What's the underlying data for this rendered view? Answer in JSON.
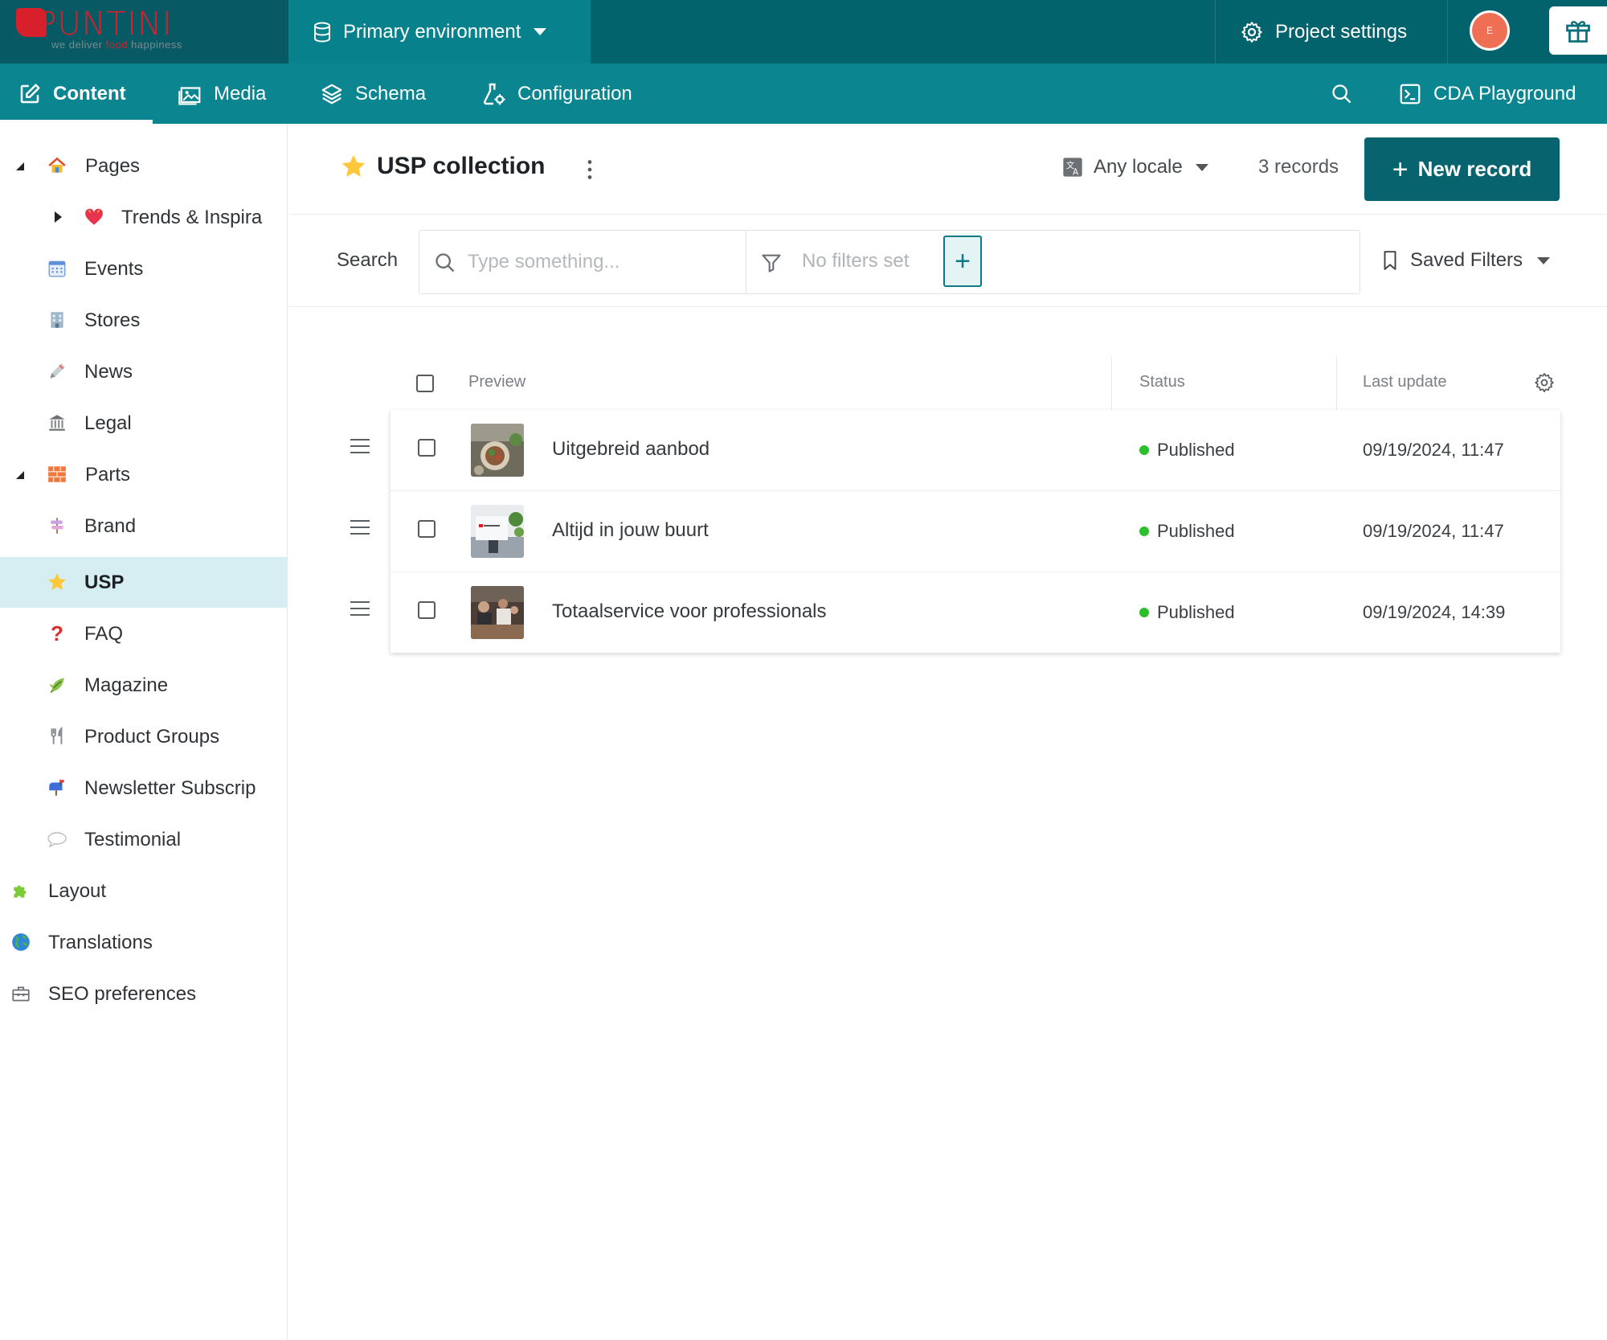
{
  "brand": {
    "name": "SPUNTINI",
    "tagline_pre": "we deliver ",
    "tagline_mid": "food",
    "tagline_post": " happiness"
  },
  "topbar": {
    "environment": "Primary environment",
    "project_settings": "Project settings",
    "avatar_initial": "E"
  },
  "nav": {
    "content": "Content",
    "media": "Media",
    "schema": "Schema",
    "configuration": "Configuration",
    "cda_playground": "CDA Playground"
  },
  "sidebar": {
    "items": [
      {
        "label": "Pages",
        "icon": "house-icon"
      },
      {
        "label": "Trends & Inspira",
        "icon": "heart-icon"
      },
      {
        "label": "Events",
        "icon": "calendar-icon"
      },
      {
        "label": "Stores",
        "icon": "building-icon"
      },
      {
        "label": "News",
        "icon": "pen-icon"
      },
      {
        "label": "Legal",
        "icon": "court-icon"
      },
      {
        "label": "Parts",
        "icon": "bricks-icon"
      },
      {
        "label": "Brand",
        "icon": "signpost-icon"
      },
      {
        "label": "USP",
        "icon": "star-icon"
      },
      {
        "label": "FAQ",
        "icon": "question-icon"
      },
      {
        "label": "Magazine",
        "icon": "leaf-icon"
      },
      {
        "label": "Product Groups",
        "icon": "cutlery-icon"
      },
      {
        "label": "Newsletter Subscrip",
        "icon": "mailbox-icon"
      },
      {
        "label": "Testimonial",
        "icon": "speech-bubble-icon"
      },
      {
        "label": "Layout",
        "icon": "puzzle-icon"
      },
      {
        "label": "Translations",
        "icon": "globe-icon"
      },
      {
        "label": "SEO preferences",
        "icon": "toolbox-icon"
      }
    ]
  },
  "header": {
    "title": "USP collection",
    "locale": "Any locale",
    "records": "3 records",
    "new_record": "New record"
  },
  "search": {
    "label": "Search",
    "placeholder": "Type something...",
    "filters": "No filters set",
    "saved_filters": "Saved Filters"
  },
  "table": {
    "columns": {
      "preview": "Preview",
      "status": "Status",
      "last_update": "Last update"
    },
    "rows": [
      {
        "title": "Uitgebreid aanbod",
        "status": "Published",
        "updated": "09/19/2024, 11:47"
      },
      {
        "title": "Altijd in jouw buurt",
        "status": "Published",
        "updated": "09/19/2024, 11:47"
      },
      {
        "title": "Totaalservice voor professionals",
        "status": "Published",
        "updated": "09/19/2024, 14:39"
      }
    ]
  },
  "colors": {
    "topbar": "#02636d",
    "navbar": "#0b8690",
    "primary_button": "#07646e",
    "active_sidebar": "#d6eef1",
    "published": "#2bbf2b"
  }
}
